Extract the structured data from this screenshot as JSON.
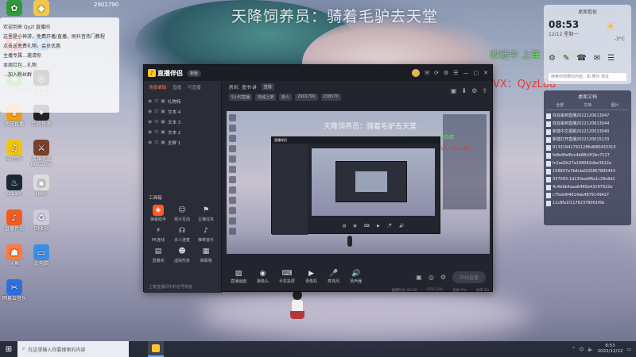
{
  "watermark": {
    "title": "天降饲养员：骑着毛驴去天堂",
    "green": "收徒中 上车 拒绝白嫖",
    "red": "VX：QyzL88"
  },
  "notification": {
    "lines": [
      "欢迎到来 Qyzl 直播间",
      "这里是小神游，免费开播/直播，刷抖音热门教程",
      "点击送免费礼物，会员优惠",
      "主播专属…邀请你",
      "本周红包…礼物",
      "…加入粉丝群"
    ]
  },
  "top_mini": {
    "text": "2901790"
  },
  "desktop_icons": [
    {
      "label": "Hao123",
      "glyph": "✿",
      "color": "#2f9a3c"
    },
    {
      "label": "",
      "glyph": "◆",
      "color": "#f3c74a"
    },
    {
      "label": "",
      "glyph": "✖",
      "color": "#d9402e"
    },
    {
      "label": "",
      "glyph": "✉",
      "color": "#2d7cf0"
    },
    {
      "label": "360安全卫士",
      "glyph": "◉",
      "color": "#3fae45"
    },
    {
      "label": "网易UU加速器",
      "glyph": "◎",
      "color": "#1f1f1f"
    },
    {
      "label": "虎牙直播",
      "glyph": "♛",
      "color": "#f39c12"
    },
    {
      "label": "超级快速",
      "glyph": "✦",
      "color": "#222"
    },
    {
      "label": "QQ音乐",
      "glyph": "♫",
      "color": "#f1c40f"
    },
    {
      "label": "英雄联盟WeGame",
      "glyph": "⚔",
      "color": "#7b3f2b"
    },
    {
      "label": "Steam",
      "glyph": "♨",
      "color": "#1b2838"
    },
    {
      "label": "Uber",
      "glyph": "▣",
      "color": "#ddd"
    },
    {
      "label": "直播伴侣",
      "glyph": "♪",
      "color": "#f25c21"
    },
    {
      "label": "回收站",
      "glyph": "♻",
      "color": "#ccd"
    },
    {
      "label": "斗鱼",
      "glyph": "☗",
      "color": "#ff7a3c"
    },
    {
      "label": "此电脑",
      "glyph": "▭",
      "color": "#3a8ee6"
    },
    {
      "label": "网易云音乐",
      "glyph": "✂",
      "color": "#2e6fe0"
    }
  ],
  "widget": {
    "header": "桌面看板",
    "time": "08:53",
    "date": "12/12 星期一",
    "weather_icon": "☀",
    "temp": "-3°C",
    "icons": [
      "⚙",
      "✎",
      "☎",
      "✉",
      "☰"
    ],
    "search": "搜索你想要的内容，如 照片 地址"
  },
  "filepanel": {
    "header": "桌面文档",
    "tabs": [
      "全部",
      "文档",
      "图片"
    ],
    "files": [
      "欢迎来到直播2022120613047",
      "欢迎来到直播2022120613044",
      "新建中文视频2022120013040",
      "新建打开直播2022120015133",
      "913319417921286d680433310",
      "fe8e9fef6cc4b88c0f2bc7127",
      "fc2ad2b27a108082dbe3622e",
      "158807e7b8cbd325857895443",
      "337083-1d130ea4f6a1c29c8d1",
      "4c4b9b4aaa6495b43197922e",
      "c75eb9f4614ab4879149427",
      "11c8fa1f11762378001f6b"
    ]
  },
  "app": {
    "name": "直播伴侣",
    "version": "新版",
    "left_tabs": [
      "场景编辑",
      "直播",
      "可直播"
    ],
    "scenes": [
      "礼物特",
      "文本 4",
      "文本 3",
      "文本 2",
      "全屏 1"
    ],
    "tools_header": "工具箱",
    "tools": [
      {
        "label": "弹幕助手",
        "icon": "◈",
        "hot": true
      },
      {
        "label": "观众互动",
        "icon": "☺",
        "hot": false
      },
      {
        "label": "主播任务",
        "icon": "⚑",
        "hot": false
      },
      {
        "label": "PK连线",
        "icon": "⚡",
        "hot": false
      },
      {
        "label": "多人连麦",
        "icon": "☊",
        "hot": false
      },
      {
        "label": "推荐音乐",
        "icon": "♪",
        "hot": false
      },
      {
        "label": "直播间",
        "icon": "▤",
        "hot": false
      },
      {
        "label": "虚拟形象",
        "icon": "☻",
        "hot": false
      },
      {
        "label": "弹幕墙",
        "icon": "▦",
        "hot": false
      }
    ],
    "left_bottom": "上麦直播间中的信号热度",
    "info": {
      "room": "房间：图书·讲",
      "tag": "直播",
      "tags": [
        "5小时直播",
        "商城上架",
        "新人",
        "2901790",
        "238070"
      ]
    },
    "header_icons": [
      "▣",
      "⬇",
      "⚙",
      "⇪"
    ],
    "controls": [
      {
        "label": "直播画面",
        "icon": "▨"
      },
      {
        "label": "摄像头",
        "icon": "◉"
      },
      {
        "label": "手机投屏",
        "icon": "⌨"
      },
      {
        "label": "录像机",
        "icon": "▶"
      },
      {
        "label": "麦克风",
        "icon": "🎤"
      },
      {
        "label": "扬声器",
        "icon": "🔊"
      }
    ],
    "go_live": "开始直播",
    "status": [
      "直播时长 00:00",
      "CPU 12%",
      "丢帧 0%",
      "帧率 60"
    ]
  },
  "taskbar": {
    "start": "⊞",
    "search_placeholder": "在这里输入你要搜索的内容",
    "time": "8:53",
    "date": "2022/12/12"
  }
}
